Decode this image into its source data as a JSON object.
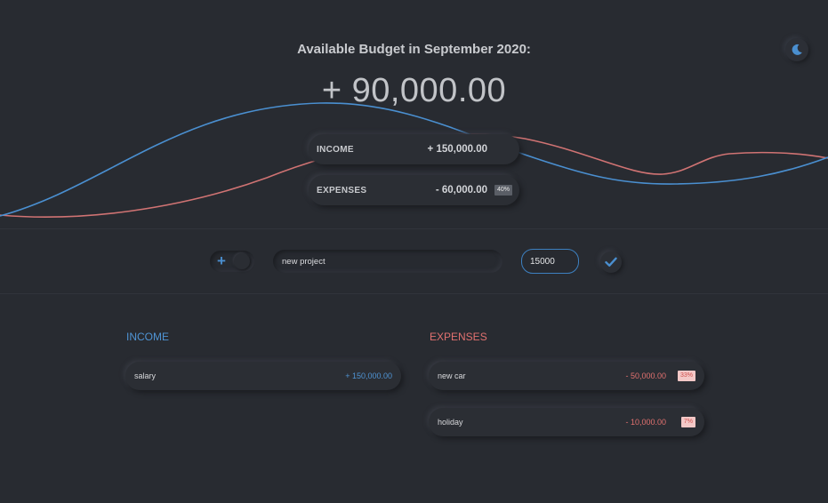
{
  "header": {
    "title": "Available Budget in September 2020:",
    "budget": "+ 90,000.00",
    "theme_icon": "moon-icon"
  },
  "summary": {
    "income_label": "INCOME",
    "income_amount": "+ 150,000.00",
    "expenses_label": "EXPENSES",
    "expenses_amount": "- 60,000.00",
    "expenses_percent": "40%"
  },
  "form": {
    "type_icon": "plus-icon",
    "description_value": "new project",
    "amount_value": "15000",
    "submit_icon": "check-icon"
  },
  "income": {
    "title": "INCOME",
    "items": [
      {
        "name": "salary",
        "value": "+ 150,000.00"
      }
    ]
  },
  "expenses": {
    "title": "EXPENSES",
    "items": [
      {
        "name": "new car",
        "value": "- 50,000.00",
        "percent": "33%"
      },
      {
        "name": "holiday",
        "value": "- 10,000.00",
        "percent": "7%"
      }
    ]
  },
  "colors": {
    "background": "#282b31",
    "income_accent": "#4f94d4",
    "expenses_accent": "#e1716f"
  }
}
